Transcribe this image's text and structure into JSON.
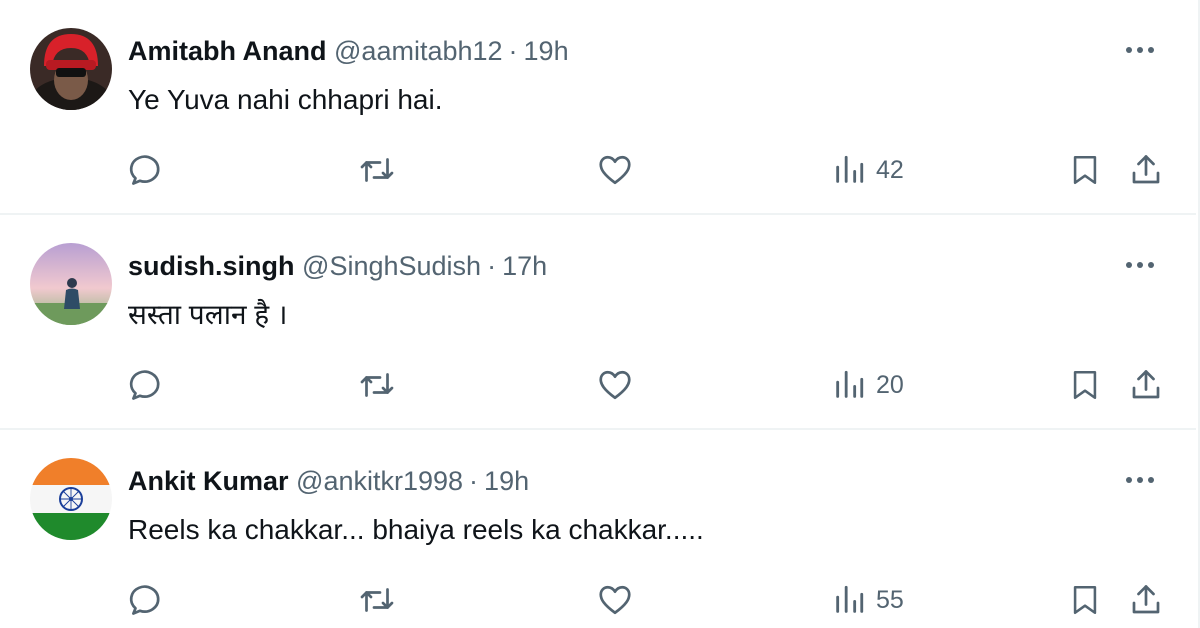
{
  "replies": [
    {
      "name": "Amitabh Anand",
      "handle": "@aamitabh12",
      "separator": "·",
      "time": "19h",
      "text": "Ye Yuva nahi chhapri hai.",
      "views": "42"
    },
    {
      "name": "sudish.singh",
      "handle": "@SinghSudish",
      "separator": "·",
      "time": "17h",
      "text": "सस्ता पलान है ।",
      "views": "20"
    },
    {
      "name": "Ankit Kumar",
      "handle": "@ankitkr1998",
      "separator": "·",
      "time": "19h",
      "text": "Reels ka chakkar... bhaiya reels ka chakkar.....",
      "views": "55"
    }
  ],
  "icons": {
    "reply": "reply-icon",
    "repost": "repost-icon",
    "like": "like-icon",
    "views": "views-icon",
    "bookmark": "bookmark-icon",
    "share": "share-icon",
    "more": "more-icon"
  },
  "colors": {
    "primary_text": "#0f1419",
    "secondary_text": "#536471",
    "divider": "#eff3f4"
  }
}
